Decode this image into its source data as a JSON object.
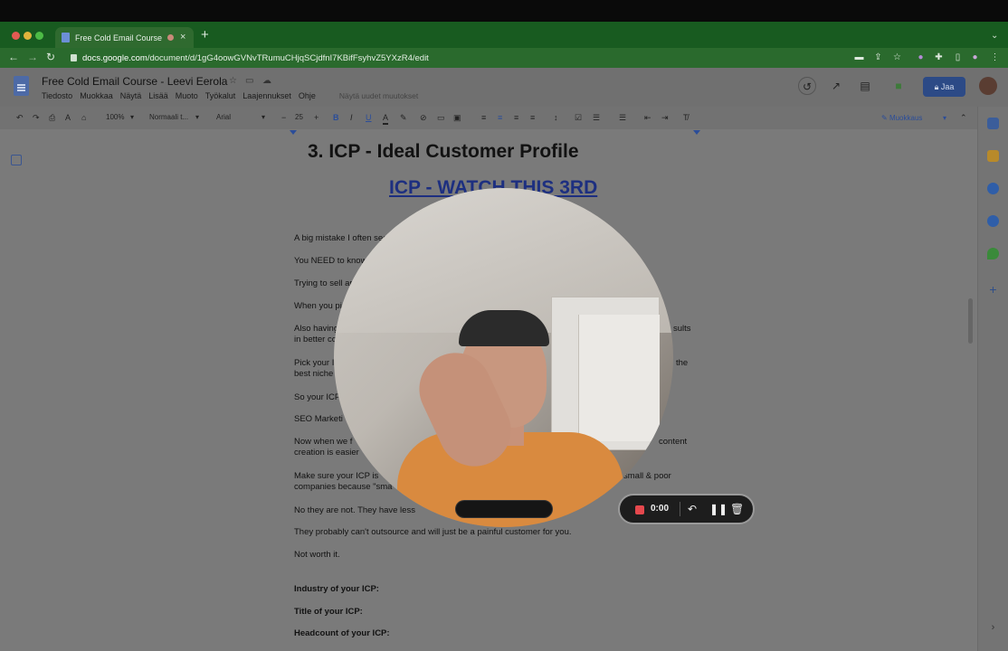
{
  "browser": {
    "tab_title": "Free Cold Email Course - L",
    "tab_close": "×",
    "new_tab": "+",
    "url_host": "docs.google.com",
    "url_path": "/document/d/1gG4oowGVNvTRumuCHjqSCjdfnI7KBifFsyhvZ5YXzR4/edit",
    "colors": {
      "chrome_green": "#185b20",
      "address_green": "#2a6a2d"
    }
  },
  "docs": {
    "title": "Free Cold Email Course - Leevi Eerola",
    "menu": [
      "Tiedosto",
      "Muokkaa",
      "Näytä",
      "Lisää",
      "Muoto",
      "Työkalut",
      "Laajennukset",
      "Ohje"
    ],
    "menu_hint": "Näytä uudet muutokset",
    "share_label": "Jaa",
    "toolbar": {
      "zoom": "100%",
      "style": "Normaali t...",
      "font": "Arial",
      "font_size": "25",
      "mode": "Muokkaus"
    }
  },
  "document": {
    "heading": "3.  ICP - Ideal Customer Profile",
    "link": "ICP - WATCH THIS 3RD",
    "paragraphs": [
      {
        "left": "A big mistake I often see",
        "right": ""
      },
      {
        "left": "You NEED to know",
        "right": ""
      },
      {
        "left": "Trying to sell ar",
        "right": ""
      },
      {
        "left": "When you pi",
        "right": ""
      },
      {
        "left": "Also having",
        "right": "sults"
      },
      {
        "left": "in better co",
        "right": ""
      },
      {
        "left": "Pick your I",
        "right": "the"
      },
      {
        "left": "best niche",
        "right": ""
      },
      {
        "left": "So your ICP",
        "right": ""
      },
      {
        "left": "SEO Marketi",
        "right": ""
      },
      {
        "left": "Now when we f",
        "right": "content"
      },
      {
        "left": "creation is easier",
        "right": ""
      },
      {
        "left": "Make sure your ICP is",
        "right": "small & poor"
      },
      {
        "left": "companies because \"sma",
        "right": ""
      },
      {
        "left": "No they are not. They have less",
        "right": ""
      },
      {
        "left": "They probably can't outsource and will just be a painful customer for you.",
        "right": ""
      },
      {
        "left": "Not worth it.",
        "right": ""
      }
    ],
    "fields": [
      "Industry of your ICP:",
      "Title of your ICP:",
      "Headcount of your ICP:"
    ]
  },
  "recorder": {
    "time": "0:00",
    "rec_color": "#e5484d"
  }
}
